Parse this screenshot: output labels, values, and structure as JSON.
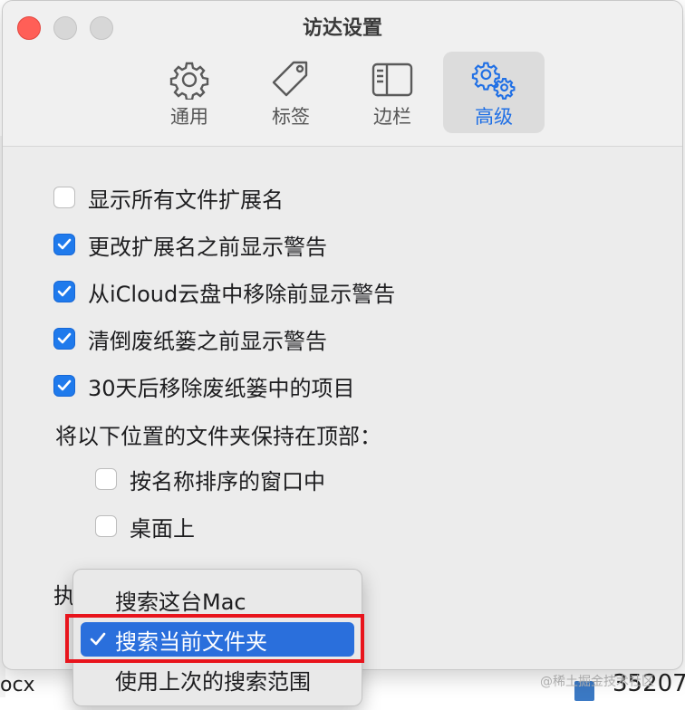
{
  "window": {
    "title": "访达设置"
  },
  "tabs": [
    {
      "label": "通用",
      "icon": "gear-icon",
      "active": false
    },
    {
      "label": "标签",
      "icon": "tag-icon",
      "active": false
    },
    {
      "label": "边栏",
      "icon": "sidebar-icon",
      "active": false
    },
    {
      "label": "高级",
      "icon": "gears-icon",
      "active": true
    }
  ],
  "options": [
    {
      "label": "显示所有文件扩展名",
      "checked": false
    },
    {
      "label": "更改扩展名之前显示警告",
      "checked": true
    },
    {
      "label": "从iCloud云盘中移除前显示警告",
      "checked": true
    },
    {
      "label": "清倒废纸篓之前显示警告",
      "checked": true
    },
    {
      "label": "30天后移除废纸篓中的项目",
      "checked": true
    }
  ],
  "keep_folders_label": "将以下位置的文件夹保持在顶部：",
  "keep_folders": [
    {
      "label": "按名称排序的窗口中",
      "checked": false
    },
    {
      "label": "桌面上",
      "checked": false
    }
  ],
  "search_label_fragment": "执",
  "search_menu": {
    "items": [
      {
        "label": "搜索这台Mac",
        "selected": false
      },
      {
        "label": "搜索当前文件夹",
        "selected": true
      },
      {
        "label": "使用上次的搜索范围",
        "selected": false
      }
    ]
  },
  "background": {
    "file_fragment": "ocx",
    "size_fragment": "35207",
    "watermark": "@稀土掘金技术社区"
  },
  "colors": {
    "accent": "#1f6fe5",
    "highlight_border": "#e8141c",
    "close": "#ff5f57"
  }
}
